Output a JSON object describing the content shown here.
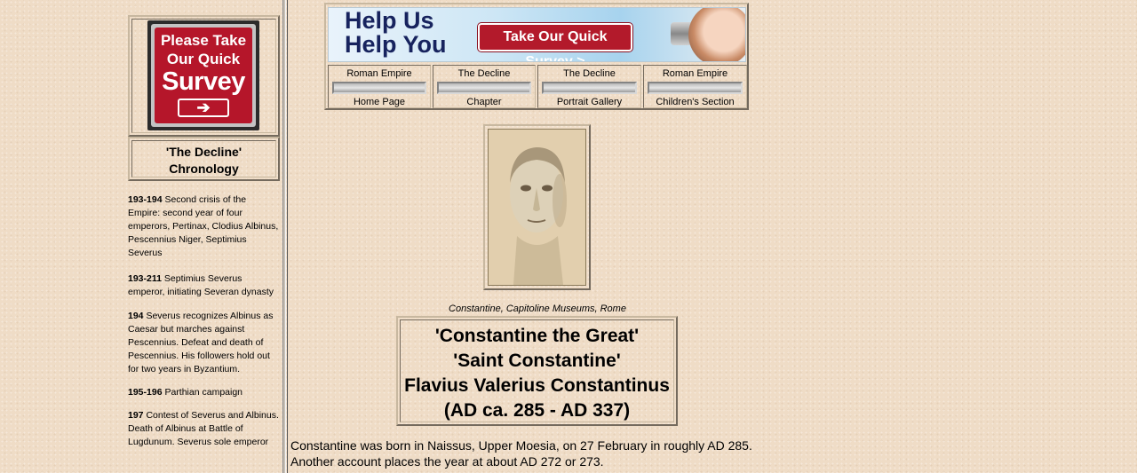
{
  "survey_sign": {
    "line1": "Please Take",
    "line2": "Our Quick",
    "line3": "Survey",
    "arrow_icon": "arrow-right-icon"
  },
  "chronology": {
    "title_line1": "'The Decline'",
    "title_line2": "Chronology"
  },
  "timeline": [
    {
      "years": "193-194",
      "text": " Second crisis of the Empire: second year of four emperors, Pertinax, Clodius Albinus, Pescennius Niger, Septimius Severus"
    },
    {
      "years": "193-211",
      "text": " Septimius Severus emperor, initiating Severan dynasty"
    },
    {
      "years": "194",
      "text": " Severus recognizes Albinus as Caesar but marches against Pescennius. Defeat and death of Pescennius. His followers hold out for two years in Byzantium."
    },
    {
      "years": "195-196",
      "text": " Parthian campaign"
    },
    {
      "years": "197",
      "text": " Contest of Severus and Albinus. Death of Albinus at Battle of Lugdunum. Severus sole emperor"
    }
  ],
  "banner": {
    "line1": "Help Us",
    "line2": "Help You",
    "cta": "Take Our Quick Survey >"
  },
  "nav": [
    {
      "top": "Roman Empire",
      "bottom": "Home Page"
    },
    {
      "top": "The Decline",
      "bottom": "Chapter"
    },
    {
      "top": "The Decline",
      "bottom": "Portrait Gallery"
    },
    {
      "top": "Roman Empire",
      "bottom": "Children's Section"
    }
  ],
  "portrait": {
    "caption": "Constantine, Capitoline Museums, Rome"
  },
  "title": {
    "line1": "'Constantine the Great'",
    "line2": "'Saint Constantine'",
    "line3": "Flavius Valerius Constantinus",
    "line4": "(AD ca. 285 - AD 337)"
  },
  "intro": {
    "line1": "Constantine was born in Naissus, Upper Moesia, on 27 February in roughly AD 285.",
    "line2": "Another account places the year at about AD 272 or 273."
  }
}
